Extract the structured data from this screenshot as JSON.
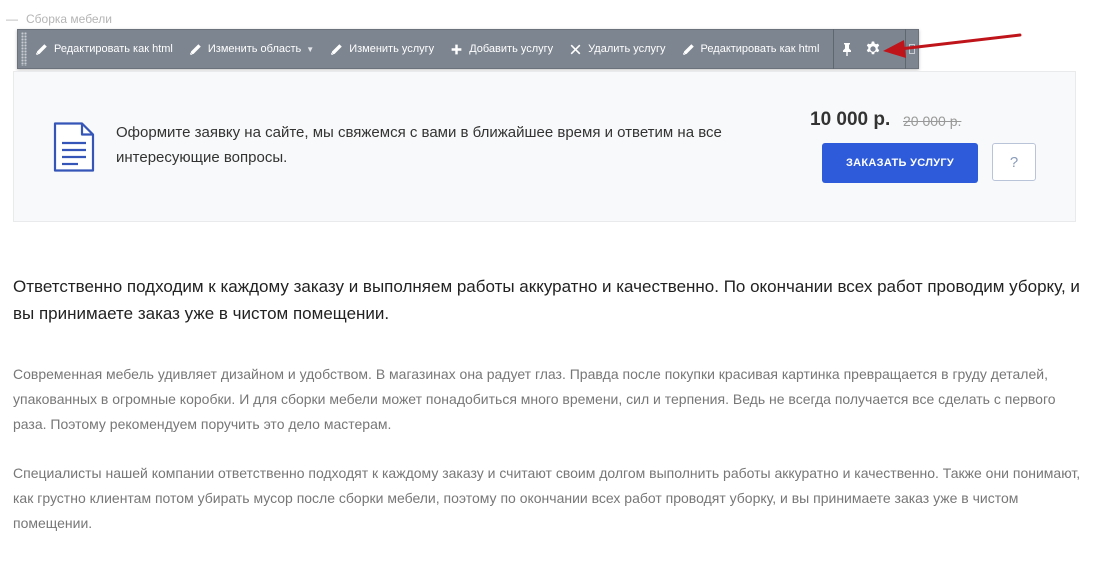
{
  "breadcrumb": {
    "dash": "—",
    "label": "Сборка мебели"
  },
  "toolbar": {
    "buttons": [
      {
        "label": "Редактировать как html",
        "icon": "pencil-icon"
      },
      {
        "label": "Изменить область",
        "icon": "pencil-icon",
        "has_dropdown": true
      },
      {
        "label": "Изменить услугу",
        "icon": "pencil-icon"
      },
      {
        "label": "Добавить услугу",
        "icon": "plus-icon"
      },
      {
        "label": "Удалить услугу",
        "icon": "close-icon"
      },
      {
        "label": "Редактировать как html",
        "icon": "pencil-icon"
      }
    ],
    "pin_icon": "pin-icon",
    "settings_icon": "gear-icon"
  },
  "offer": {
    "text": "Оформите заявку на сайте, мы свяжемся с вами в ближайшее время и ответим на все интересующие вопросы.",
    "price": "10 000 р.",
    "old_price": "20 000 р.",
    "order_label": "ЗАКАЗАТЬ УСЛУГУ",
    "question_label": "?"
  },
  "content": {
    "lead": "Ответственно подходим к каждому заказу и выполняем работы аккуратно и качественно. По окончании всех работ проводим уборку, и вы принимаете заказ уже в чистом помещении.",
    "paragraph1": "Современная мебель удивляет дизайном и удобством. В магазинах она радует глаз. Правда после покупки красивая картинка превращается в груду деталей, упакованных в огромные коробки. И для сборки мебели может понадобиться много времени, сил и терпения. Ведь не всегда получается все сделать с первого раза. Поэтому рекомендуем поручить это дело мастерам.",
    "paragraph2": "Специалисты нашей компании ответственно подходят к каждому заказу и считают своим долгом выполнить работы аккуратно и качественно. Также они понимают, как грустно клиентам потом убирать мусор после сборки мебели, поэтому по окончании всех работ проводят уборку, и вы принимаете заказ уже в чистом помещении."
  },
  "colors": {
    "toolbar_bg": "#7d8590",
    "accent": "#2e5bd9",
    "annotation_arrow": "#c0141b"
  }
}
